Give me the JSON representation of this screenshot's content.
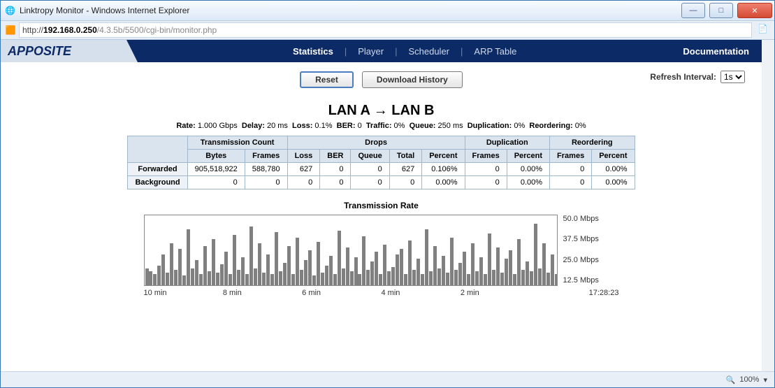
{
  "window": {
    "title": "Linktropy Monitor - Windows Internet Explorer",
    "url_prefix": "http://",
    "url_host": "192.168.0.250",
    "url_rest": "/4.3.5b/5500/cgi-bin/monitor.php"
  },
  "nav": {
    "logo": "APPOSITE",
    "links": [
      "Statistics",
      "Player",
      "Scheduler",
      "ARP Table"
    ],
    "active": "Statistics",
    "docs": "Documentation"
  },
  "buttons": {
    "reset": "Reset",
    "download": "Download History"
  },
  "refresh": {
    "label": "Refresh Interval:",
    "value": "1s"
  },
  "heading": "LAN A → LAN B",
  "meta": {
    "Rate": "1.000 Gbps",
    "Delay": "20 ms",
    "Loss": "0.1%",
    "BER": "0",
    "Traffic": "0%",
    "Queue": "250 ms",
    "Duplication": "0%",
    "Reordering": "0%"
  },
  "table": {
    "groups": [
      "Transmission Count",
      "Drops",
      "Duplication",
      "Reordering"
    ],
    "cols": [
      "Bytes",
      "Frames",
      "Loss",
      "BER",
      "Queue",
      "Total",
      "Percent",
      "Frames",
      "Percent",
      "Frames",
      "Percent"
    ],
    "rows": [
      {
        "label": "Forwarded",
        "cells": [
          "905,518,922",
          "588,780",
          "627",
          "0",
          "0",
          "627",
          "0.106%",
          "0",
          "0.00%",
          "0",
          "0.00%"
        ]
      },
      {
        "label": "Background",
        "cells": [
          "0",
          "0",
          "0",
          "0",
          "0",
          "0",
          "0.00%",
          "0",
          "0.00%",
          "0",
          "0.00%"
        ]
      }
    ]
  },
  "chart_data": {
    "type": "bar",
    "title": "Transmission Rate",
    "ylabel": "Mbps",
    "ylim": [
      0,
      50
    ],
    "yticks": [
      12.5,
      25.0,
      37.5,
      50.0
    ],
    "xticks": [
      "10 min",
      "8 min",
      "6 min",
      "4 min",
      "2 min",
      "17:28:23"
    ],
    "values": [
      12,
      10,
      8,
      14,
      22,
      9,
      30,
      11,
      26,
      7,
      40,
      12,
      18,
      8,
      28,
      10,
      33,
      9,
      15,
      24,
      8,
      36,
      11,
      20,
      8,
      42,
      12,
      30,
      9,
      22,
      8,
      38,
      10,
      16,
      28,
      8,
      34,
      11,
      18,
      25,
      7,
      31,
      9,
      14,
      21,
      8,
      39,
      12,
      27,
      10,
      20,
      8,
      35,
      11,
      17,
      24,
      8,
      29,
      10,
      13,
      22,
      26,
      8,
      32,
      11,
      19,
      8,
      40,
      10,
      28,
      12,
      21,
      9,
      34,
      11,
      16,
      24,
      8,
      30,
      10,
      20,
      8,
      37,
      11,
      27,
      9,
      19,
      25,
      8,
      33,
      11,
      17,
      10,
      44,
      12,
      30,
      9,
      22,
      8,
      36
    ]
  },
  "status": {
    "zoom": "100%"
  }
}
